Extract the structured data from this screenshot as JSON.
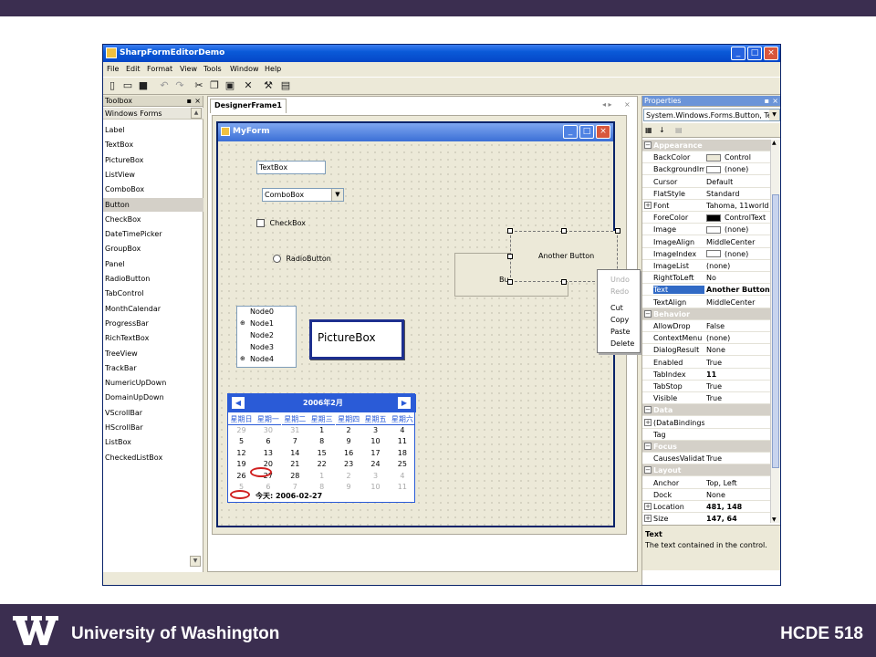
{
  "slide": {
    "university": "University of Washington",
    "course": "HCDE 518",
    "brand_color": "#3b2e50"
  },
  "app": {
    "title": "SharpFormEditorDemo",
    "menu": [
      "File",
      "Edit",
      "Format",
      "View",
      "Tools",
      "Window",
      "Help"
    ],
    "toolbar_icons": [
      "new-icon",
      "open-icon",
      "save-icon",
      "undo-icon",
      "redo-icon",
      "cut-icon",
      "copy-icon",
      "paste-icon",
      "delete-icon",
      "tools-icon",
      "properties-icon"
    ]
  },
  "toolbox": {
    "title": "Toolbox",
    "section": "Windows Forms",
    "items": [
      "Label",
      "TextBox",
      "PictureBox",
      "ListView",
      "ComboBox",
      "Button",
      "CheckBox",
      "DateTimePicker",
      "GroupBox",
      "Panel",
      "RadioButton",
      "TabControl",
      "MonthCalendar",
      "ProgressBar",
      "RichTextBox",
      "TreeView",
      "TrackBar",
      "NumericUpDown",
      "DomainUpDown",
      "VScrollBar",
      "HScrollBar",
      "ListBox",
      "CheckedListBox"
    ],
    "selected": "Button"
  },
  "document": {
    "tab": "DesignerFrame1",
    "form_title": "MyForm",
    "textbox": "TextBox",
    "combobox": "ComboBox",
    "checkbox": "CheckBox",
    "radiobutton": "RadioButton",
    "button_selected": "Another Button",
    "button_behind": "Bu",
    "tree_nodes": [
      "Node0",
      "Node1",
      "Node2",
      "Node3",
      "Node4"
    ],
    "picturebox": "PictureBox",
    "context_menu": [
      {
        "label": "Undo",
        "enabled": false
      },
      {
        "label": "Redo",
        "enabled": false
      },
      {
        "label": "Cut",
        "enabled": true
      },
      {
        "label": "Copy",
        "enabled": true
      },
      {
        "label": "Paste",
        "enabled": true
      },
      {
        "label": "Delete",
        "enabled": true
      }
    ],
    "calendar": {
      "month": "2006年2月",
      "weekdays": [
        "星期日",
        "星期一",
        "星期二",
        "星期三",
        "星期四",
        "星期五",
        "星期六"
      ],
      "weeks": [
        [
          "29",
          "30",
          "31",
          "1",
          "2",
          "3",
          "4"
        ],
        [
          "5",
          "6",
          "7",
          "8",
          "9",
          "10",
          "11"
        ],
        [
          "12",
          "13",
          "14",
          "15",
          "16",
          "17",
          "18"
        ],
        [
          "19",
          "20",
          "21",
          "22",
          "23",
          "24",
          "25"
        ],
        [
          "26",
          "27",
          "28",
          "1",
          "2",
          "3",
          "4"
        ],
        [
          "5",
          "6",
          "7",
          "8",
          "9",
          "10",
          "11"
        ]
      ],
      "today_label": "今天: 2006-02-27",
      "header_color": "#2a5bd7",
      "selected_day": "27"
    }
  },
  "properties": {
    "title": "Properties",
    "object": "System.Windows.Forms.Button, Te",
    "rows": [
      {
        "cat": "Appearance"
      },
      {
        "n": "BackColor",
        "v": "Control",
        "sw": "#ece9d8"
      },
      {
        "n": "BackgroundIm",
        "v": "(none)",
        "sw": "#ffffff"
      },
      {
        "n": "Cursor",
        "v": "Default"
      },
      {
        "n": "FlatStyle",
        "v": "Standard"
      },
      {
        "n": "Font",
        "v": "Tahoma, 11world",
        "exp": true
      },
      {
        "n": "ForeColor",
        "v": "ControlText",
        "sw": "#000000"
      },
      {
        "n": "Image",
        "v": "(none)",
        "sw": "#ffffff"
      },
      {
        "n": "ImageAlign",
        "v": "MiddleCenter"
      },
      {
        "n": "ImageIndex",
        "v": "(none)",
        "sw": "#ffffff"
      },
      {
        "n": "ImageList",
        "v": "(none)"
      },
      {
        "n": "RightToLeft",
        "v": "No"
      },
      {
        "n": "Text",
        "v": "Another Button",
        "sel": true,
        "bold": true
      },
      {
        "n": "TextAlign",
        "v": "MiddleCenter"
      },
      {
        "cat": "Behavior"
      },
      {
        "n": "AllowDrop",
        "v": "False"
      },
      {
        "n": "ContextMenu",
        "v": "(none)"
      },
      {
        "n": "DialogResult",
        "v": "None"
      },
      {
        "n": "Enabled",
        "v": "True"
      },
      {
        "n": "TabIndex",
        "v": "11",
        "bold": true
      },
      {
        "n": "TabStop",
        "v": "True"
      },
      {
        "n": "Visible",
        "v": "True"
      },
      {
        "cat": "Data"
      },
      {
        "n": "(DataBindings)",
        "v": "",
        "exp": true
      },
      {
        "n": "Tag",
        "v": ""
      },
      {
        "cat": "Focus"
      },
      {
        "n": "CausesValidati",
        "v": "True"
      },
      {
        "cat": "Layout"
      },
      {
        "n": "Anchor",
        "v": "Top, Left"
      },
      {
        "n": "Dock",
        "v": "None"
      },
      {
        "n": "Location",
        "v": "481, 148",
        "bold": true,
        "exp": true
      },
      {
        "n": "Size",
        "v": "147, 64",
        "bold": true,
        "exp": true
      }
    ],
    "desc_title": "Text",
    "desc_text": "The text contained in the control."
  }
}
